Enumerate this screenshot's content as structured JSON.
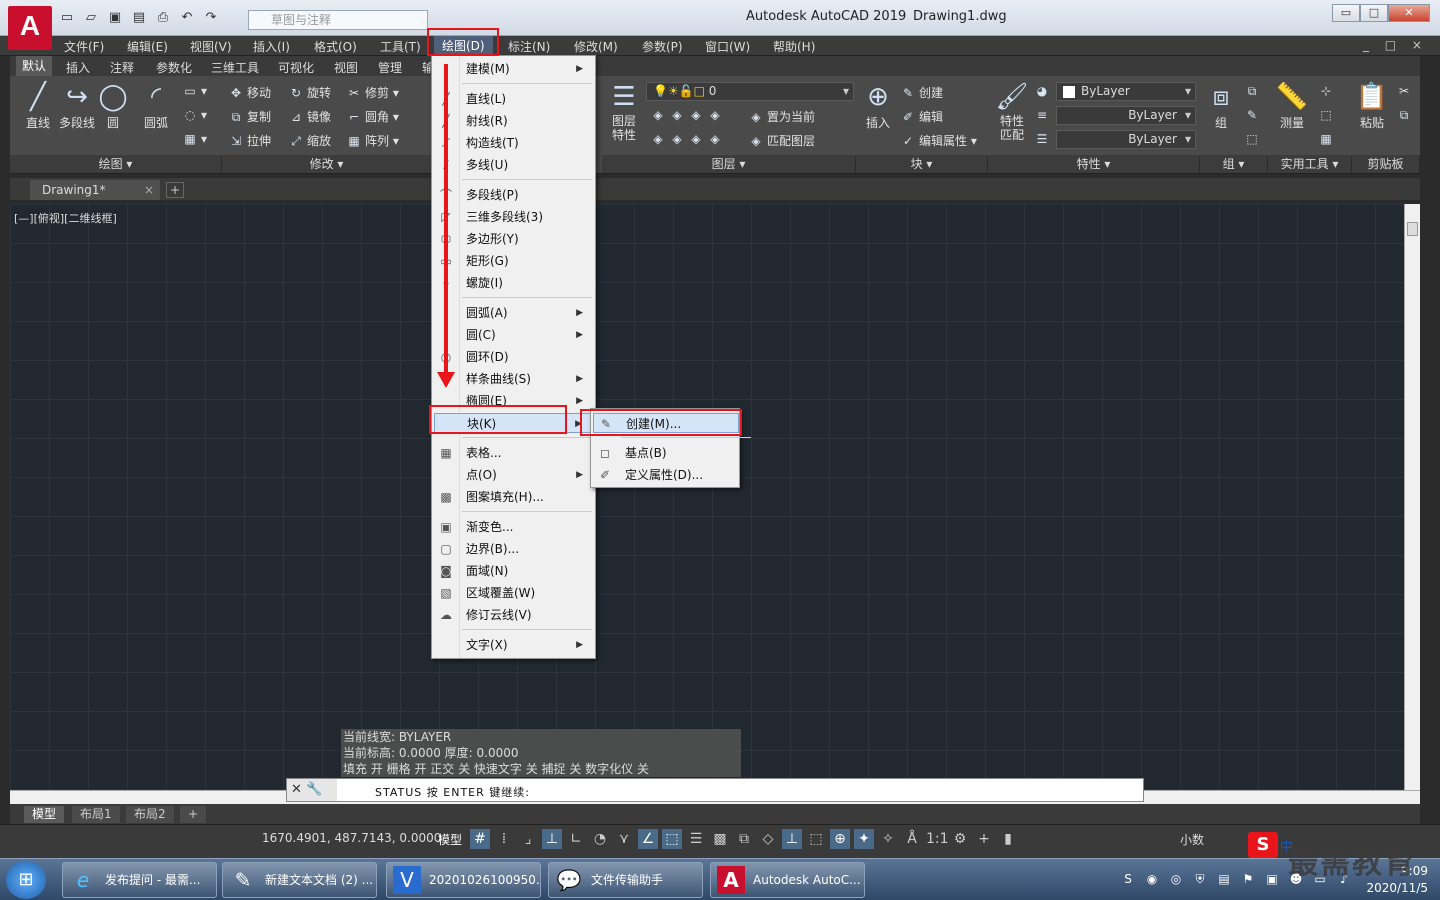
{
  "titlebar": {
    "app_logo": "A",
    "title": "Autodesk AutoCAD 2019",
    "file": "Drawing1.dwg",
    "workspace_placeholder": "草图与注释",
    "win_buttons": [
      "▭",
      "□",
      "✕"
    ]
  },
  "menubar": {
    "items": [
      "文件(F)",
      "编辑(E)",
      "视图(V)",
      "插入(I)",
      "格式(O)",
      "工具(T)",
      "绘图(D)",
      "标注(N)",
      "修改(M)",
      "参数(P)",
      "窗口(W)",
      "帮助(H)"
    ],
    "win_buttons": "_ □ ×"
  },
  "ribbon_tabs": [
    "默认",
    "插入",
    "注释",
    "参数化",
    "三维工具",
    "可视化",
    "视图",
    "管理",
    "输"
  ],
  "ribbon": {
    "draw": {
      "tools": [
        "直线",
        "多段线",
        "圆",
        "圆弧"
      ],
      "title": "绘图 ▾"
    },
    "modify": {
      "tools": [
        "移动",
        "旋转",
        "修剪",
        "复制",
        "镜像",
        "圆角",
        "拉伸",
        "缩放",
        "阵列"
      ],
      "title": "修改 ▾"
    },
    "layers": {
      "tool": "图层\n特性",
      "current_layer": "0",
      "set_current": "置为当前",
      "match_layer": "匹配图层",
      "title": "图层 ▾"
    },
    "block": {
      "insert": "插入",
      "create": "创建",
      "edit": "编辑",
      "edit_attr": "编辑属性",
      "title": "块 ▾"
    },
    "properties": {
      "match": "特性\n匹配",
      "color": "ByLayer",
      "linetype": "ByLayer",
      "lineweight": "ByLayer",
      "title": "特性 ▾"
    },
    "group": {
      "tool": "组",
      "title": "组 ▾"
    },
    "utilities": {
      "tool": "测量",
      "title": "实用工具 ▾"
    },
    "clipboard": {
      "tool": "粘贴",
      "title": "剪贴板"
    }
  },
  "doctabs": {
    "active": "Drawing1*",
    "close": "×",
    "add": "+"
  },
  "canvas": {
    "view_label": "[—][俯视][二维线框]"
  },
  "command": {
    "history": [
      "当前线宽:               BYLAYER",
      "当前标高:           0.0000   厚度:     0.0000",
      "填充 开  栅格 开  正交 关  快速文字 关  捕捉 关  数字化仪 关"
    ],
    "prompt": "STATUS 按 ENTER 键继续:",
    "left_icons": "✕ 🔧"
  },
  "layout_tabs": [
    "模型",
    "布局1",
    "布局2",
    "+"
  ],
  "statusbar": {
    "coords": "1670.4901, 487.7143, 0.0000",
    "model": "模型",
    "decimal": "小数"
  },
  "draw_menu": {
    "items": [
      {
        "label": "建模(M)",
        "sub": true,
        "icon": ""
      },
      {
        "label": "直线(L)",
        "sub": false,
        "icon": "╱"
      },
      {
        "label": "射线(R)",
        "sub": false,
        "icon": "╱"
      },
      {
        "label": "构造线(T)",
        "sub": false,
        "icon": "⟋"
      },
      {
        "label": "多线(U)",
        "sub": false,
        "icon": "⫽"
      },
      {
        "label": "多段线(P)",
        "sub": false,
        "icon": "⌒"
      },
      {
        "label": "三维多段线(3)",
        "sub": false,
        "icon": "◸"
      },
      {
        "label": "多边形(Y)",
        "sub": false,
        "icon": "⬡"
      },
      {
        "label": "矩形(G)",
        "sub": false,
        "icon": "▭"
      },
      {
        "label": "螺旋(I)",
        "sub": false,
        "icon": "§"
      },
      {
        "label": "圆弧(A)",
        "sub": true,
        "icon": ""
      },
      {
        "label": "圆(C)",
        "sub": true,
        "icon": ""
      },
      {
        "label": "圆环(D)",
        "sub": false,
        "icon": "◎"
      },
      {
        "label": "样条曲线(S)",
        "sub": true,
        "icon": ""
      },
      {
        "label": "椭圆(E)",
        "sub": true,
        "icon": ""
      },
      {
        "label": "块(K)",
        "sub": true,
        "icon": ""
      },
      {
        "label": "表格...",
        "sub": false,
        "icon": "▦"
      },
      {
        "label": "点(O)",
        "sub": true,
        "icon": ""
      },
      {
        "label": "图案填充(H)...",
        "sub": false,
        "icon": "▩"
      },
      {
        "label": "渐变色...",
        "sub": false,
        "icon": "▣"
      },
      {
        "label": "边界(B)...",
        "sub": false,
        "icon": "▢"
      },
      {
        "label": "面域(N)",
        "sub": false,
        "icon": "◙"
      },
      {
        "label": "区域覆盖(W)",
        "sub": false,
        "icon": "▧"
      },
      {
        "label": "修订云线(V)",
        "sub": false,
        "icon": "☁"
      },
      {
        "label": "文字(X)",
        "sub": true,
        "icon": ""
      }
    ]
  },
  "block_submenu": {
    "items": [
      {
        "label": "创建(M)...",
        "icon": "✎"
      },
      {
        "label": "基点(B)",
        "icon": "◻"
      },
      {
        "label": "定义属性(D)...",
        "icon": "✐"
      }
    ]
  },
  "taskbar": {
    "start": "⊞",
    "items": [
      {
        "label": "发布提问 - 最需...",
        "icon": "e"
      },
      {
        "label": "新建文本文档 (2) ...",
        "icon": "✎"
      },
      {
        "label": "20201026100950...",
        "icon": "V"
      },
      {
        "label": "文件传输助手",
        "icon": "💬"
      },
      {
        "label": "Autodesk AutoC...",
        "icon": "A"
      }
    ],
    "time": "9:09",
    "date": "2020/11/5"
  },
  "watermark": {
    "logo": "S",
    "cn": "中",
    "text": "最需教育"
  },
  "colors": {
    "highlight_box": "#e8161b",
    "canvas_bg": "#212830",
    "ribbon_bg": "#4a4a4a"
  }
}
